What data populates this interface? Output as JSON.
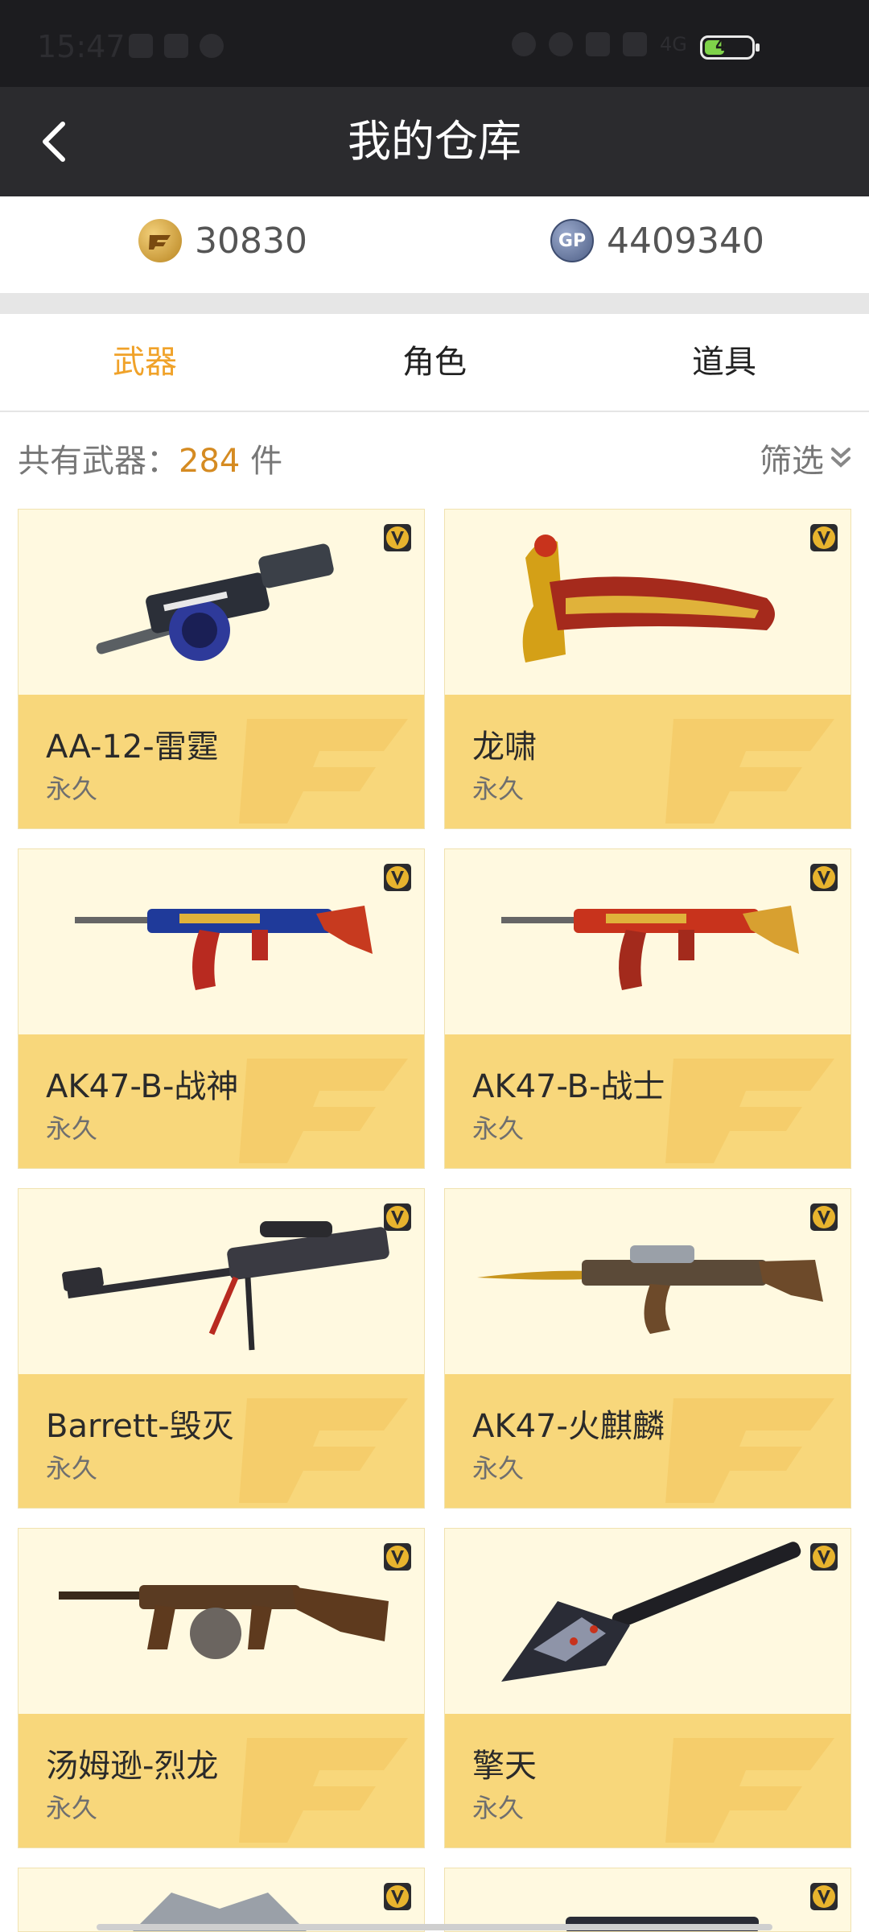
{
  "status_bar": {
    "time": "15:47",
    "network": "4G",
    "battery_level": "4"
  },
  "header": {
    "title": "我的仓库",
    "back_icon": "chevron-left-icon"
  },
  "currency": {
    "cf_points": "30830",
    "gp_points": "4409340",
    "gp_label": "GP"
  },
  "tabs": [
    {
      "label": "武器",
      "active": true
    },
    {
      "label": "角色",
      "active": false
    },
    {
      "label": "道具",
      "active": false
    }
  ],
  "summary": {
    "prefix": "共有武器：",
    "count": "284",
    "unit": "件"
  },
  "filter": {
    "label": "筛选"
  },
  "items": [
    {
      "name": "AA-12-雷霆",
      "duration": "永久",
      "icon": "drum-shotgun-icon"
    },
    {
      "name": "龙啸",
      "duration": "永久",
      "icon": "dragon-axe-icon"
    },
    {
      "name": "AK47-B-战神",
      "duration": "永久",
      "icon": "rifle-icon"
    },
    {
      "name": "AK47-B-战士",
      "duration": "永久",
      "icon": "rifle-icon"
    },
    {
      "name": "Barrett-毁灭",
      "duration": "永久",
      "icon": "sniper-rifle-icon"
    },
    {
      "name": "AK47-火麒麟",
      "duration": "永久",
      "icon": "rifle-icon"
    },
    {
      "name": "汤姆逊-烈龙",
      "duration": "永久",
      "icon": "tommy-gun-icon"
    },
    {
      "name": "擎天",
      "duration": "永久",
      "icon": "shovel-icon"
    }
  ],
  "colors": {
    "accent": "#f0a229",
    "count": "#d58b22",
    "card_bg": "#fff9e0",
    "card_band": "#f8d77b"
  }
}
